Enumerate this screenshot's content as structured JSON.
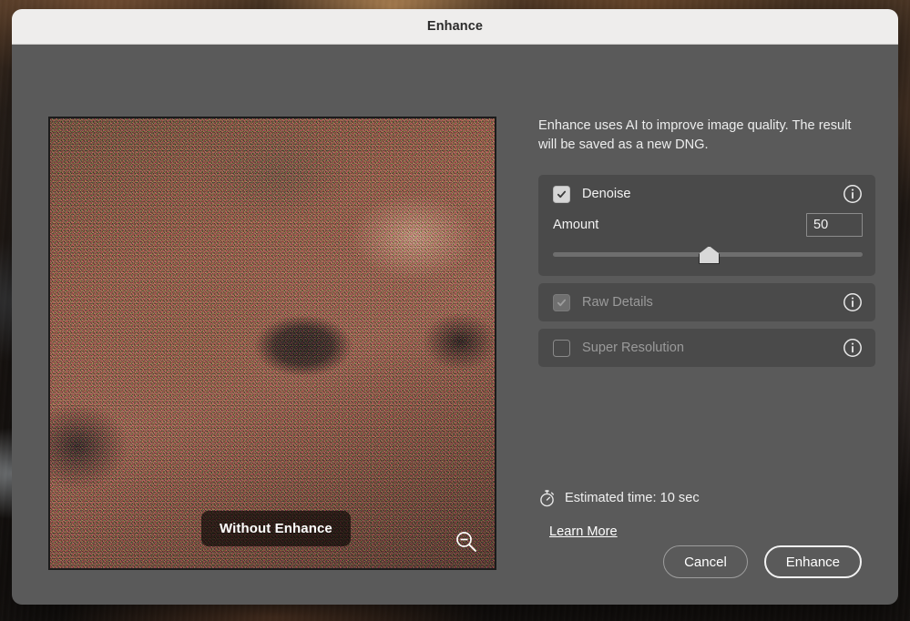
{
  "window": {
    "title": "Enhance"
  },
  "preview": {
    "badge_label": "Without Enhance",
    "zoom_icon": "zoom-out-magnifier-icon"
  },
  "panel": {
    "description": "Enhance uses AI to improve image quality. The result will be saved as a new DNG.",
    "options": [
      {
        "label": "Denoise",
        "checked": true,
        "enabled": true,
        "info_icon": "info-circle-icon",
        "slider": {
          "label": "Amount",
          "value": "50",
          "min": 0,
          "max": 100,
          "percent": 50
        }
      },
      {
        "label": "Raw Details",
        "checked": true,
        "enabled": false,
        "info_icon": "info-circle-icon"
      },
      {
        "label": "Super Resolution",
        "checked": false,
        "enabled": false,
        "info_icon": "info-circle-icon"
      }
    ],
    "estimate": {
      "icon": "stopwatch-icon",
      "text": "Estimated time: 10 sec"
    },
    "learn_more_label": "Learn More"
  },
  "footer": {
    "cancel_label": "Cancel",
    "enhance_label": "Enhance"
  },
  "colors": {
    "dialog_body": "#5a5a5a",
    "titlebar": "#eeedec",
    "option_row": "#4a4a4a",
    "text_primary": "#f2f2f2",
    "text_disabled": "#9a9a9a"
  }
}
